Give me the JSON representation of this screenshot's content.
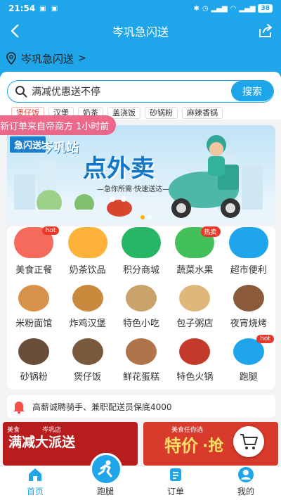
{
  "status_bar": {
    "time": "21:54",
    "battery": "38"
  },
  "nav": {
    "title": "岑巩急闪送"
  },
  "location": {
    "label": "岑巩急闪送",
    "chevron": ">"
  },
  "search": {
    "placeholder": "满减优惠送不停",
    "button_label": "搜索"
  },
  "hot_tags": [
    "煲仔饭",
    "汉堡",
    "奶茶",
    "盖浇饭",
    "砂锅粉",
    "麻辣香锅"
  ],
  "toast": "新订单来自帝商方  1小时前",
  "banner": {
    "brand": "急闪送",
    "store": "岑巩站",
    "headline": "点外卖",
    "sub": "—急你所需·快速送达—"
  },
  "categories": [
    {
      "label": "美食正餐",
      "badge": "hot",
      "icon": "food-icon",
      "color": "#f56a5a"
    },
    {
      "label": "奶茶饮品",
      "badge": "",
      "icon": "milk-tea-icon",
      "color": "#ffb23a"
    },
    {
      "label": "积分商城",
      "badge": "",
      "icon": "coins-icon",
      "color": "#27b566"
    },
    {
      "label": "蔬菜水果",
      "badge": "热卖",
      "icon": "fruit-icon",
      "color": "#43c05a"
    },
    {
      "label": "超市便利",
      "badge": "",
      "icon": "basket-icon",
      "color": "#1ea5ea"
    },
    {
      "label": "米粉面馆",
      "badge": "",
      "icon": "noodle-icon",
      "color": "#d8914a"
    },
    {
      "label": "炸鸡汉堡",
      "badge": "",
      "icon": "burger-icon",
      "color": "#c98a3d"
    },
    {
      "label": "特色小吃",
      "badge": "",
      "icon": "snack-icon",
      "color": "#c9a36a"
    },
    {
      "label": "包子粥店",
      "badge": "",
      "icon": "bun-icon",
      "color": "#e0b77a"
    },
    {
      "label": "夜宵烧烤",
      "badge": "",
      "icon": "bbq-icon",
      "color": "#8a5a3a"
    },
    {
      "label": "砂锅粉",
      "badge": "",
      "icon": "claypot-icon",
      "color": "#6b4e3a"
    },
    {
      "label": "煲仔饭",
      "badge": "",
      "icon": "rice-pot-icon",
      "color": "#7a5a3c"
    },
    {
      "label": "鲜花蛋糕",
      "badge": "",
      "icon": "cake-icon",
      "color": "#b0744a"
    },
    {
      "label": "特色火锅",
      "badge": "",
      "icon": "hotpot-icon",
      "color": "#c33a2a"
    },
    {
      "label": "跑腿",
      "badge": "hot",
      "icon": "runner-icon",
      "color": "#1ea5ea"
    }
  ],
  "notice": "高薪诚聘骑手、兼职配送员保底4000",
  "promos": {
    "left": {
      "small": "美食",
      "small2": "岑巩店",
      "big": "满减大派送"
    },
    "right": {
      "small": "美食任你选",
      "big": "特价",
      "big2": "·抢"
    }
  },
  "tabs": [
    {
      "label": "首页",
      "icon": "home-icon",
      "active": true
    },
    {
      "label": "跑腿",
      "icon": "runner-icon",
      "active": false
    },
    {
      "label": "订单",
      "icon": "order-icon",
      "active": false
    },
    {
      "label": "我的",
      "icon": "user-icon",
      "active": false
    }
  ],
  "colors": {
    "primary": "#1ea5ea",
    "hot": "#e8392b"
  }
}
